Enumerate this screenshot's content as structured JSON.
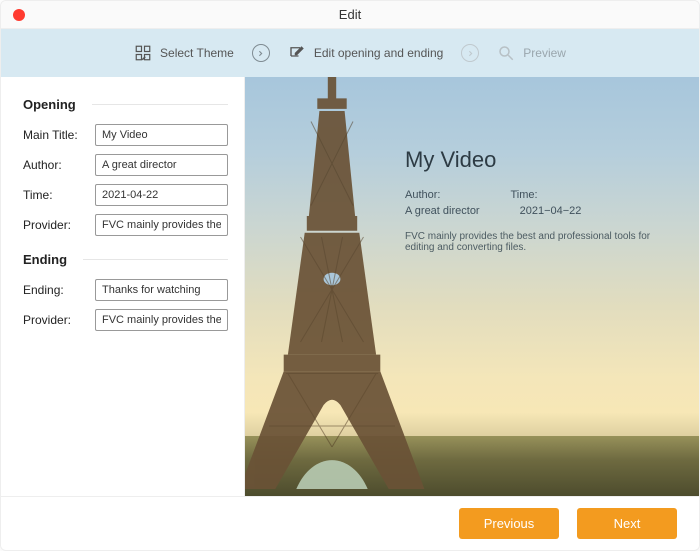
{
  "window": {
    "title": "Edit"
  },
  "steps": {
    "select_theme": "Select Theme",
    "edit_opening_ending": "Edit opening and ending",
    "preview": "Preview"
  },
  "opening": {
    "heading": "Opening",
    "main_title_label": "Main Title:",
    "main_title_value": "My Video",
    "author_label": "Author:",
    "author_value": "A great director",
    "time_label": "Time:",
    "time_value": "2021-04-22",
    "provider_label": "Provider:",
    "provider_value": "FVC mainly provides the best and professional tools for editing and converting files."
  },
  "ending": {
    "heading": "Ending",
    "ending_label": "Ending:",
    "ending_value": "Thanks for watching",
    "provider_label": "Provider:",
    "provider_value": "FVC mainly provides the best and professional tools for editing and converting files."
  },
  "preview": {
    "title": "My Video",
    "author_label": "Author:",
    "time_label": "Time:",
    "author_value": "A great director",
    "time_value": "2021−04−22",
    "description": "FVC mainly provides the best and professional tools for editing and converting files."
  },
  "footer": {
    "previous": "Previous",
    "next": "Next"
  },
  "colors": {
    "accent": "#f39b1f",
    "stepbar": "#d7e9f2",
    "close_dot": "#ff3b30"
  }
}
